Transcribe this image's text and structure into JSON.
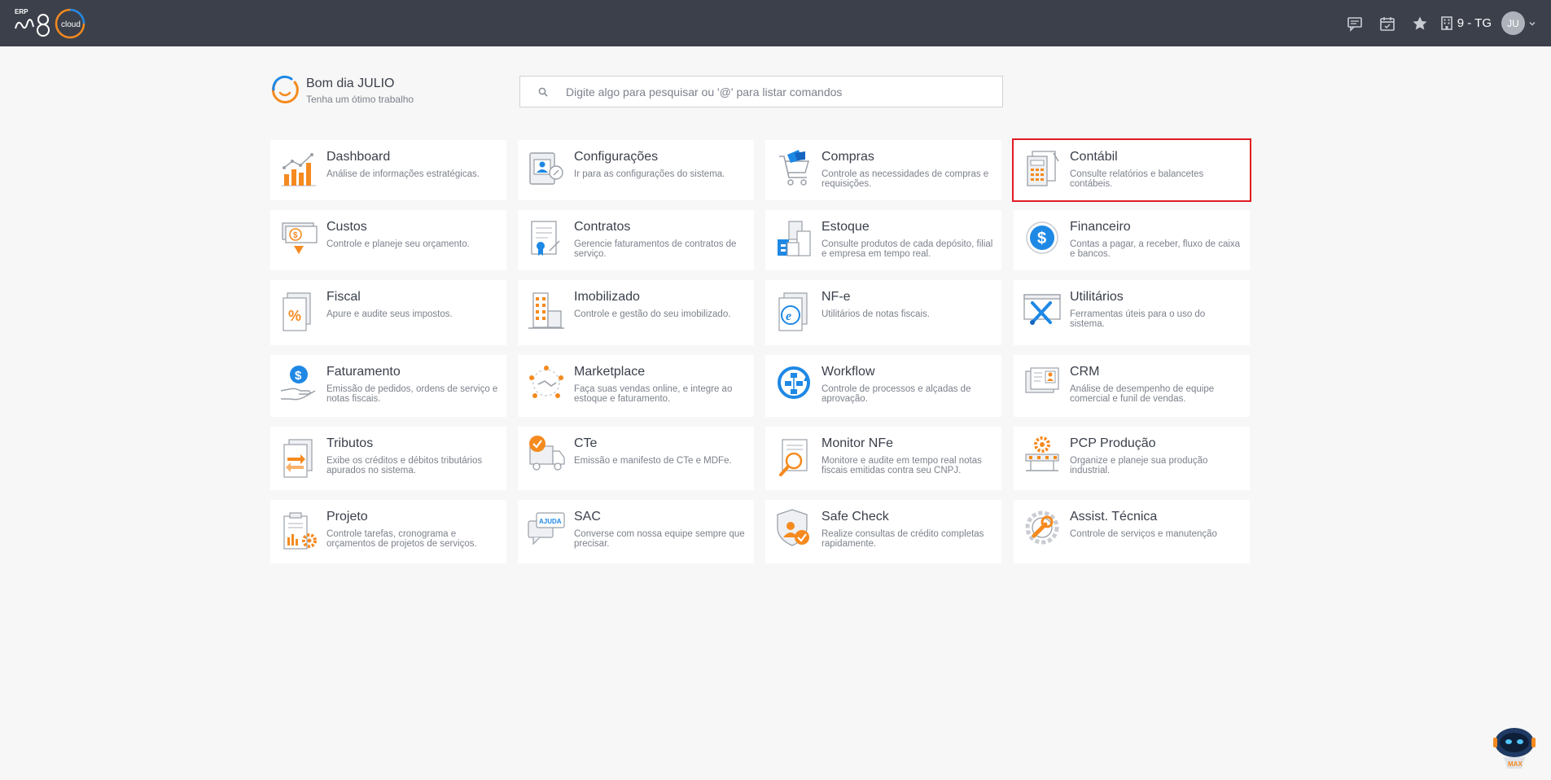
{
  "header": {
    "logo_text": {
      "erp": "ERP",
      "brand": "m8",
      "cloud": "cloud"
    },
    "icons": [
      "chat-icon",
      "calendar-icon",
      "star-icon",
      "building-icon",
      "chevron-down-icon"
    ],
    "company": "9 - TG",
    "avatar_initials": "JU"
  },
  "greeting": {
    "title": "Bom dia JULIO",
    "subtitle": "Tenha um ótimo trabalho"
  },
  "search": {
    "placeholder": "Digite algo para pesquisar ou '@' para listar comandos",
    "value": ""
  },
  "modules": [
    {
      "title": "Dashboard",
      "desc": "Análise de informações estratégicas.",
      "icon": "dashboard-chart-icon"
    },
    {
      "title": "Configurações",
      "desc": "Ir para as configurações do sistema.",
      "icon": "settings-profile-icon"
    },
    {
      "title": "Compras",
      "desc": "Controle as necessidades de compras e requisições.",
      "icon": "shopping-cart-icon"
    },
    {
      "title": "Contábil",
      "desc": "Consulte relatórios e balancetes contábeis.",
      "icon": "accounting-calculator-icon"
    },
    {
      "title": "Custos",
      "desc": "Controle e planeje seu orçamento.",
      "icon": "costs-money-icon"
    },
    {
      "title": "Contratos",
      "desc": "Gerencie faturamentos de contratos de serviço.",
      "icon": "contract-document-icon"
    },
    {
      "title": "Estoque",
      "desc": "Consulte produtos de cada depósito, filial e empresa em tempo real.",
      "icon": "stock-boxes-icon"
    },
    {
      "title": "Financeiro",
      "desc": "Contas a pagar, a receber, fluxo de caixa e bancos.",
      "icon": "finance-dollar-icon"
    },
    {
      "title": "Fiscal",
      "desc": "Apure e audite seus impostos.",
      "icon": "fiscal-percent-icon"
    },
    {
      "title": "Imobilizado",
      "desc": "Controle e gestão do seu imobilizado.",
      "icon": "building-assets-icon"
    },
    {
      "title": "NF-e",
      "desc": "Utilitários de notas fiscais.",
      "icon": "nfe-document-icon"
    },
    {
      "title": "Utilitários",
      "desc": "Ferramentas úteis para o uso do sistema.",
      "icon": "tools-icon"
    },
    {
      "title": "Faturamento",
      "desc": "Emissão de pedidos, ordens de serviço e notas fiscais.",
      "icon": "billing-hand-dollar-icon"
    },
    {
      "title": "Marketplace",
      "desc": "Faça suas vendas online, e integre ao estoque e faturamento.",
      "icon": "marketplace-network-icon"
    },
    {
      "title": "Workflow",
      "desc": "Controle de processos e alçadas de aprovação.",
      "icon": "workflow-icon"
    },
    {
      "title": "CRM",
      "desc": "Análise de desempenho de equipe comercial e funil de vendas.",
      "icon": "crm-card-icon"
    },
    {
      "title": "Tributos",
      "desc": "Exibe os créditos e débitos tributários apurados no sistema.",
      "icon": "taxes-arrows-icon"
    },
    {
      "title": "CTe",
      "desc": "Emissão e manifesto de CTe e MDFe.",
      "icon": "truck-check-icon"
    },
    {
      "title": "Monitor NFe",
      "desc": "Monitore e audite em tempo real notas fiscais emitidas contra seu CNPJ.",
      "icon": "magnifier-document-icon"
    },
    {
      "title": "PCP Produção",
      "desc": "Organize e planeje sua produção industrial.",
      "icon": "production-gear-icon"
    },
    {
      "title": "Projeto",
      "desc": "Controle tarefas, cronograma e orçamentos de projetos de serviços.",
      "icon": "project-clipboard-icon"
    },
    {
      "title": "SAC",
      "desc": "Converse com nossa equipe sempre que precisar.",
      "icon": "support-chat-icon",
      "badge": "AJUDA"
    },
    {
      "title": "Safe Check",
      "desc": "Realize consultas de crédito completas rapidamente.",
      "icon": "shield-check-icon"
    },
    {
      "title": "Assist. Técnica",
      "desc": "Controle de serviços e manutenção",
      "icon": "wrench-gear-icon"
    }
  ],
  "selected_module": "Contábil",
  "assistant": {
    "label": "MAX",
    "icon": "robot-assistant-icon"
  },
  "colors": {
    "topbar": "#3c404b",
    "accent_orange": "#f58a1f",
    "accent_blue": "#1e88e5",
    "selected_border": "#e11b22"
  }
}
